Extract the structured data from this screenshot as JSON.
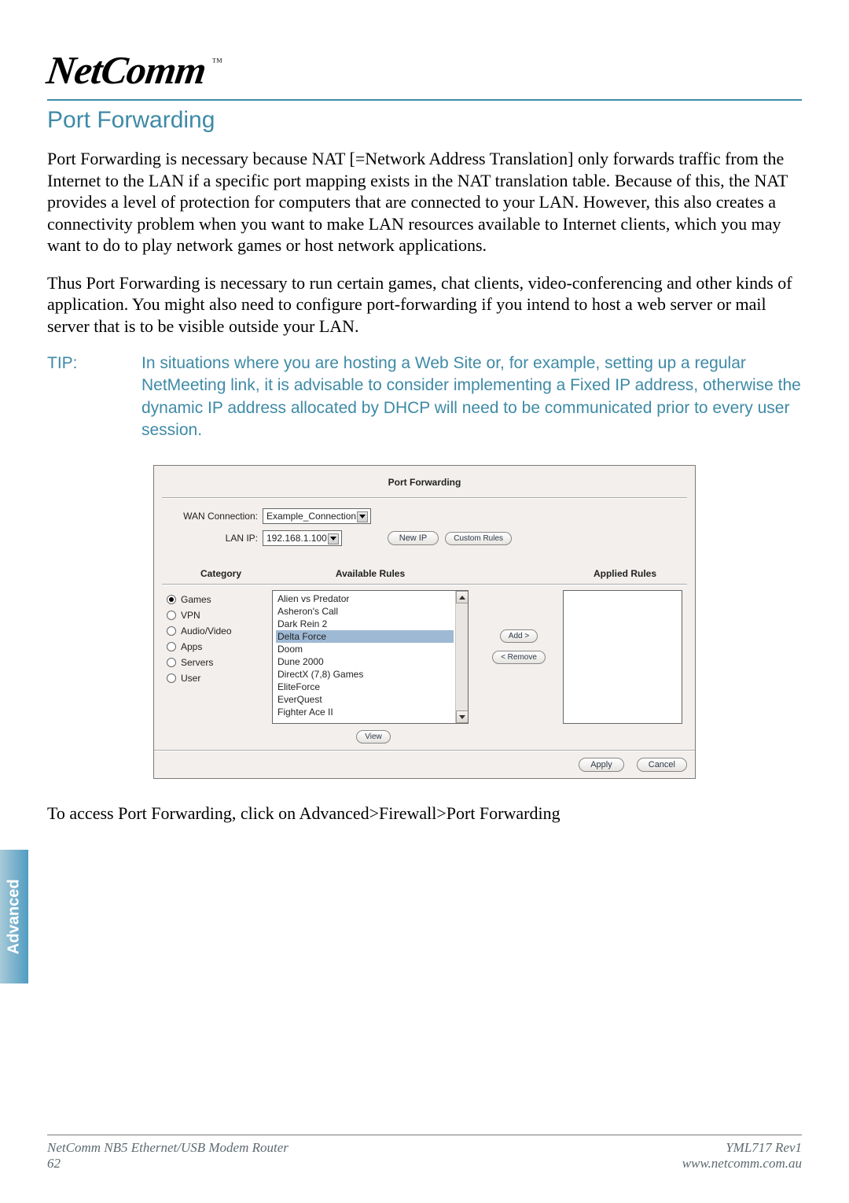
{
  "brand": {
    "logo_text": "NetComm",
    "tm": "™"
  },
  "section_title": "Port Forwarding",
  "paragraph1": "Port Forwarding is necessary because NAT [=Network Address Translation] only forwards traffic from the Internet to the LAN if a specific port mapping exists in the NAT translation table. Because of this, the NAT provides a level of protection for computers that are connected to your LAN. However, this also creates a connectivity problem when you want to make LAN resources available to Internet clients, which you may want to do to play network games or host network applications.",
  "paragraph2": "Thus Port Forwarding is necessary to run certain games, chat clients, video-conferencing and other kinds of application.  You might also need to configure port-forwarding if you intend to host a web server or mail server that is to be visible outside your LAN.",
  "tip_label": "TIP:",
  "tip_body": "In situations where you are hosting a Web Site or, for example, setting up a regular NetMeeting link, it is advisable to consider implementing a Fixed IP address, otherwise the dynamic IP address allocated by DHCP will need to be communicated prior to every user session.",
  "screenshot": {
    "title": "Port Forwarding",
    "wan_label": "WAN Connection:",
    "wan_value": "Example_Connection",
    "lan_label": "LAN IP:",
    "lan_value": "192.168.1.100",
    "new_ip_btn": "New IP",
    "custom_rules_btn": "Custom Rules",
    "headers": {
      "category": "Category",
      "available": "Available Rules",
      "applied": "Applied Rules"
    },
    "categories": [
      {
        "label": "Games",
        "checked": true
      },
      {
        "label": "VPN",
        "checked": false
      },
      {
        "label": "Audio/Video",
        "checked": false
      },
      {
        "label": "Apps",
        "checked": false
      },
      {
        "label": "Servers",
        "checked": false
      },
      {
        "label": "User",
        "checked": false
      }
    ],
    "available_rules": [
      "Alien vs Predator",
      "Asheron's Call",
      "Dark Rein 2",
      "Delta Force",
      "Doom",
      "Dune 2000",
      "DirectX (7,8) Games",
      "EliteForce",
      "EverQuest",
      "Fighter Ace II"
    ],
    "selected_rule_index": 3,
    "add_btn": "Add >",
    "remove_btn": "< Remove",
    "view_btn": "View",
    "apply_btn": "Apply",
    "cancel_btn": "Cancel"
  },
  "access_text": "To access Port Forwarding, click on Advanced>Firewall>Port Forwarding",
  "side_tab": "Advanced",
  "footer": {
    "left_line1": "NetComm NB5 Ethernet/USB Modem Router",
    "left_line2": "62",
    "right_line1": "YML717 Rev1",
    "right_line2": "www.netcomm.com.au"
  }
}
